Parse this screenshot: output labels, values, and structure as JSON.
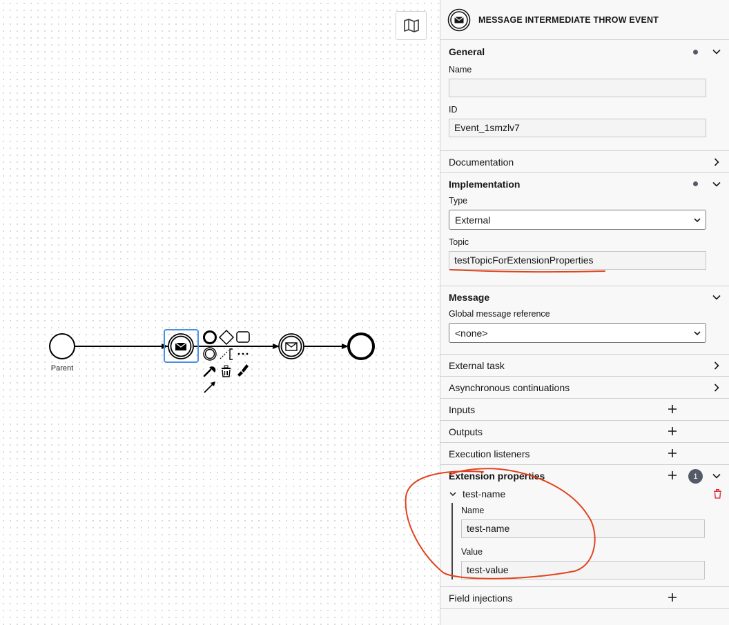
{
  "canvas": {
    "minimap_icon": "map-icon",
    "start_event_label": "Parent"
  },
  "panel": {
    "header": {
      "icon": "message-throw-event-icon",
      "title": "MESSAGE INTERMEDIATE THROW EVENT"
    },
    "general": {
      "title": "General",
      "name_label": "Name",
      "name_value": "",
      "id_label": "ID",
      "id_value": "Event_1smzlv7"
    },
    "documentation": {
      "title": "Documentation"
    },
    "implementation": {
      "title": "Implementation",
      "type_label": "Type",
      "type_value": "External",
      "topic_label": "Topic",
      "topic_value": "testTopicForExtensionProperties"
    },
    "message": {
      "title": "Message",
      "ref_label": "Global message reference",
      "ref_value": "<none>"
    },
    "external_task": {
      "title": "External task"
    },
    "async": {
      "title": "Asynchronous continuations"
    },
    "inputs": {
      "title": "Inputs"
    },
    "outputs": {
      "title": "Outputs"
    },
    "execution_listeners": {
      "title": "Execution listeners"
    },
    "extension_properties": {
      "title": "Extension properties",
      "count": "1",
      "items": [
        {
          "header": "test-name",
          "name_label": "Name",
          "name_value": "test-name",
          "value_label": "Value",
          "value_value": "test-value"
        }
      ]
    },
    "field_injections": {
      "title": "Field injections"
    }
  },
  "colors": {
    "selection": "#4a90e2",
    "annotation": "#e2431e",
    "delete": "#da1e28"
  }
}
